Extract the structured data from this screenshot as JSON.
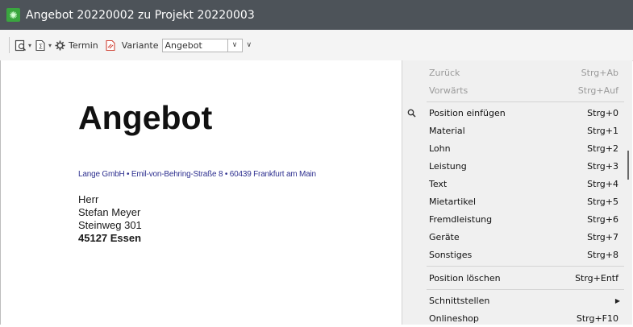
{
  "window": {
    "title": "Angebot 20220002 zu Projekt 20220003",
    "app_icon": "cog-icon",
    "titlebar_color": "#4d5359",
    "app_icon_color": "#3aa63f"
  },
  "toolbar": {
    "termin_label": "Termin",
    "variante_label": "Variante",
    "variante_value": "Angebot"
  },
  "document": {
    "title": "Angebot",
    "sender_line": "Lange GmbH • Emil-von-Behring-Straße 8 • 60439 Frankfurt am Main",
    "sender_color": "#2f3190",
    "address": {
      "salutation": "Herr",
      "name": "Stefan Meyer",
      "street": "Steinweg 301",
      "city": "45127 Essen"
    }
  },
  "context_menu": {
    "items": [
      {
        "label": "Zurück",
        "shortcut": "Strg+Ab",
        "disabled": true
      },
      {
        "label": "Vorwärts",
        "shortcut": "Strg+Auf",
        "disabled": true
      },
      {
        "label": "Position einfügen",
        "shortcut": "Strg+0",
        "icon": "search-icon"
      },
      {
        "label": "Material",
        "shortcut": "Strg+1"
      },
      {
        "label": "Lohn",
        "shortcut": "Strg+2"
      },
      {
        "label": "Leistung",
        "shortcut": "Strg+3"
      },
      {
        "label": "Text",
        "shortcut": "Strg+4"
      },
      {
        "label": "Mietartikel",
        "shortcut": "Strg+5"
      },
      {
        "label": "Fremdleistung",
        "shortcut": "Strg+6"
      },
      {
        "label": "Geräte",
        "shortcut": "Strg+7"
      },
      {
        "label": "Sonstiges",
        "shortcut": "Strg+8"
      },
      {
        "label": "Position löschen",
        "shortcut": "Strg+Entf"
      },
      {
        "label": "Schnittstellen",
        "submenu": true
      },
      {
        "label": "Onlineshop",
        "shortcut": "Strg+F10"
      }
    ]
  }
}
